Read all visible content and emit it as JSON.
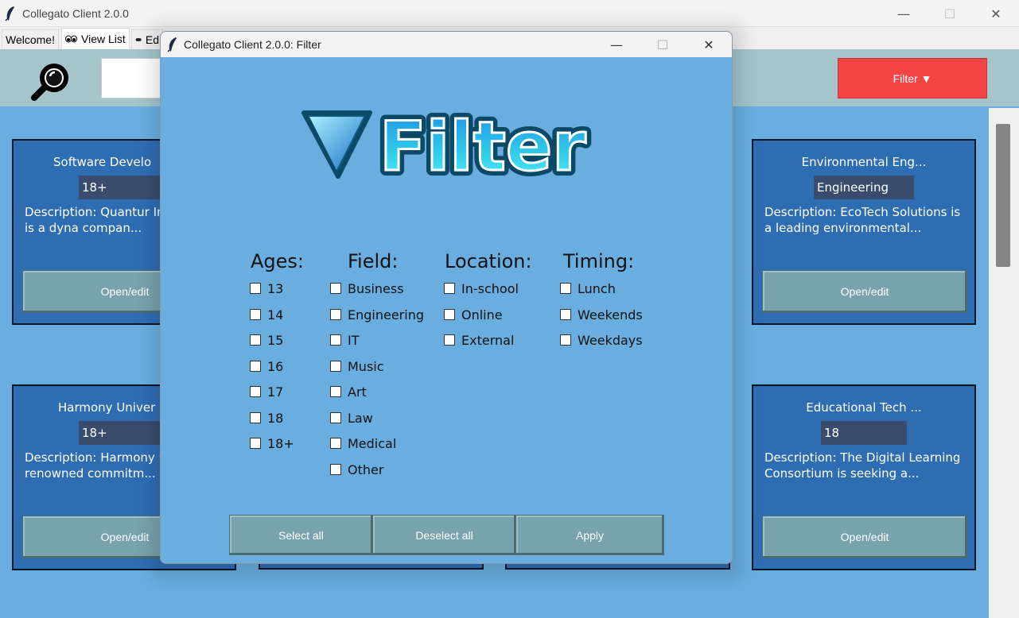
{
  "window": {
    "title": "Collegato Client 2.0.0",
    "controls": {
      "minimize": "—",
      "maximize": "☐",
      "close": "✕"
    }
  },
  "tabs": [
    {
      "label": "Welcome!",
      "icon": ""
    },
    {
      "label": "View List",
      "icon": "eyes-icon"
    },
    {
      "label": "Ed",
      "icon": "pencil-icon"
    }
  ],
  "toolbar": {
    "search_icon": "magnifier-icon",
    "search_value": "",
    "filter_label": "Filter ▼",
    "filter_color": "#f34446"
  },
  "cards": [
    {
      "title": "Software Develo",
      "tag": "18+",
      "description": "Description: Quantur Innovations is a dyna compan...",
      "button": "Open/edit"
    },
    {
      "title": "Environmental Eng...",
      "tag": "Engineering",
      "description": "Description: EcoTech Solutions is a leading environmental...",
      "button": "Open/edit"
    },
    {
      "title": "Harmony Univer",
      "tag": "18+",
      "description": "Description: Harmony University, renowned commitm...",
      "button": "Open/edit"
    },
    {
      "title": "Educational Tech ...",
      "tag": "18",
      "description": "Description: The Digital Learning Consortium is seeking a...",
      "button": "Open/edit"
    }
  ],
  "dialog": {
    "title": "Collegato Client 2.0.0: Filter",
    "logo_text": "Filter",
    "controls": {
      "minimize": "—",
      "maximize": "☐",
      "close": "✕"
    },
    "columns": [
      {
        "heading": "Ages:",
        "options": [
          "13",
          "14",
          "15",
          "16",
          "17",
          "18",
          "18+"
        ]
      },
      {
        "heading": "Field:",
        "options": [
          "Business",
          "Engineering",
          "IT",
          "Music",
          "Art",
          "Law",
          "Medical",
          "Other"
        ]
      },
      {
        "heading": "Location:",
        "options": [
          "In-school",
          "Online",
          "External"
        ]
      },
      {
        "heading": "Timing:",
        "options": [
          "Lunch",
          "Weekends",
          "Weekdays"
        ]
      }
    ],
    "buttons": {
      "select_all": "Select all",
      "deselect_all": "Deselect all",
      "apply": "Apply"
    }
  },
  "colors": {
    "background": "#6aaee0",
    "card": "#2f6db3",
    "button": "#78a2ac",
    "toolbar": "#a5c5cb"
  }
}
